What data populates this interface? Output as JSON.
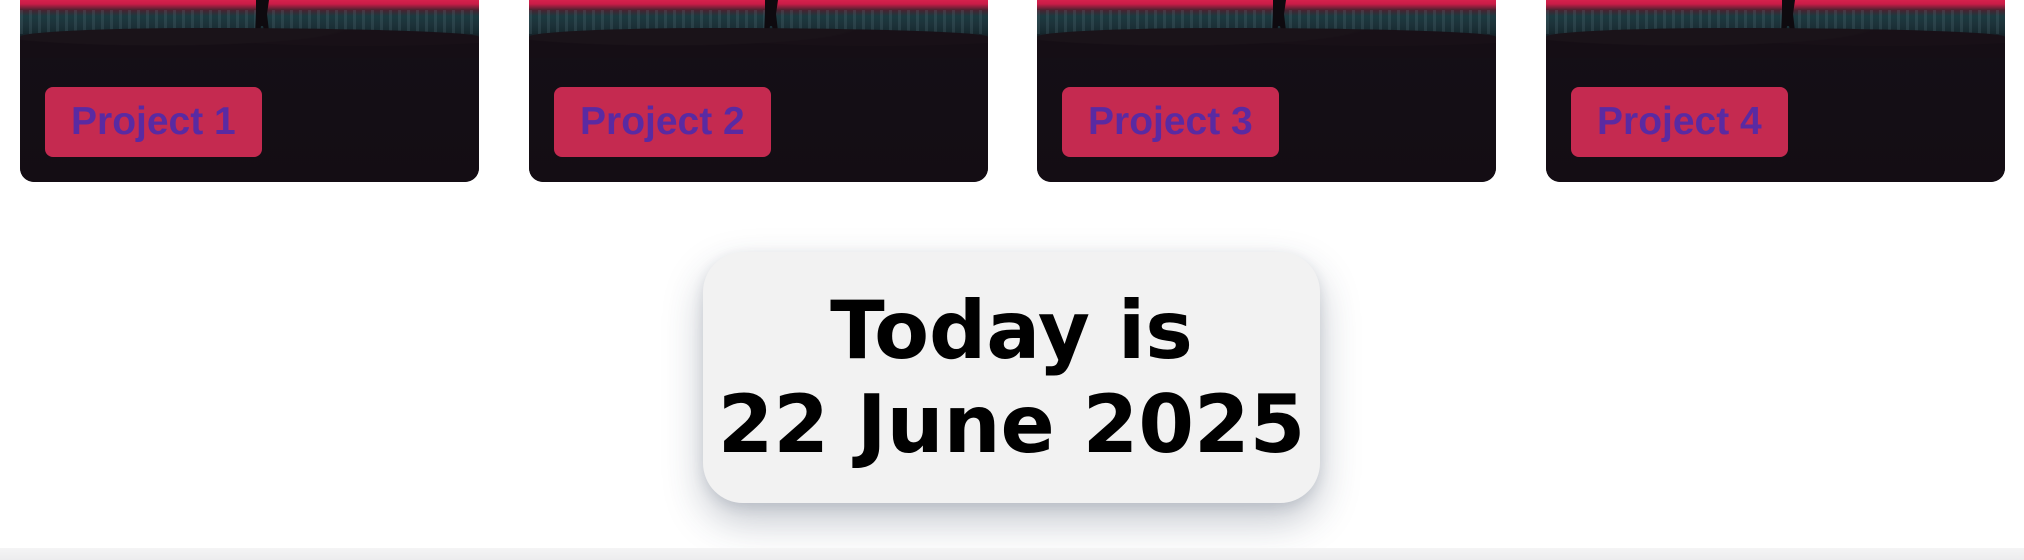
{
  "projects": {
    "items": [
      {
        "label": "Project 1"
      },
      {
        "label": "Project 2"
      },
      {
        "label": "Project 3"
      },
      {
        "label": "Project 4"
      }
    ],
    "badge_color": "#c52a50",
    "label_color": "#5a2aa2"
  },
  "date_panel": {
    "line1": "Today is",
    "line2": "22 June 2025"
  }
}
